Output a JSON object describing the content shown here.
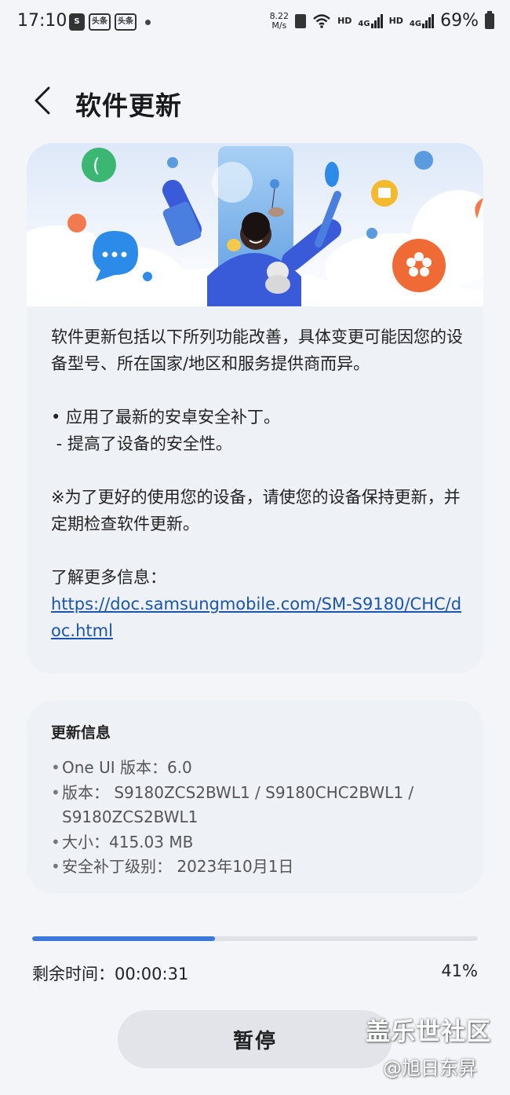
{
  "status_bar": {
    "time": "17:10",
    "app_icons": [
      "S",
      "头条",
      "头条"
    ],
    "network_speed": "8.22",
    "network_speed_unit": "M/s",
    "hd1": "HD",
    "sig1": "4G",
    "hd2": "HD",
    "sig2": "4G",
    "battery": "69%"
  },
  "header": {
    "title": "软件更新",
    "back_icon": "chevron-left-icon"
  },
  "hero": {
    "illustration": "software-update-illustration"
  },
  "description": {
    "intro": "软件更新包括以下所列功能改善，具体变更可能因您的设备型号、所在国家/地区和服务提供商而异。",
    "bullet": "• 应用了最新的安卓安全补丁。",
    "sub_bullet": " - 提高了设备的安全性。",
    "note": "※为了更好的使用您的设备，请使您的设备保持更新，并定期检查软件更新。",
    "more_info_label": "了解更多信息：",
    "link": "https://doc.samsungmobile.com/SM-S9180/CHC/doc.html"
  },
  "update_info": {
    "title": "更新信息",
    "one_ui": "One UI 版本：6.0",
    "version_line1": "版本： S9180ZCS2BWL1 / S9180CHC2BWL1 /",
    "version_line2": "S9180ZCS2BWL1",
    "size": "大小：415.03 MB",
    "security_patch": "安全补丁级别： 2023年10月1日"
  },
  "progress": {
    "value": 0.41,
    "remaining": "剩余时间：00:00:31",
    "percent": "41%"
  },
  "pause_button": {
    "label": "暂停"
  },
  "watermark": {
    "site": "盖乐世社区",
    "user": "@旭日东昇"
  },
  "colors": {
    "accent": "#3c78d8",
    "link": "#1a55b0",
    "background": "#f4f5f8",
    "card": "#eef1f6"
  }
}
